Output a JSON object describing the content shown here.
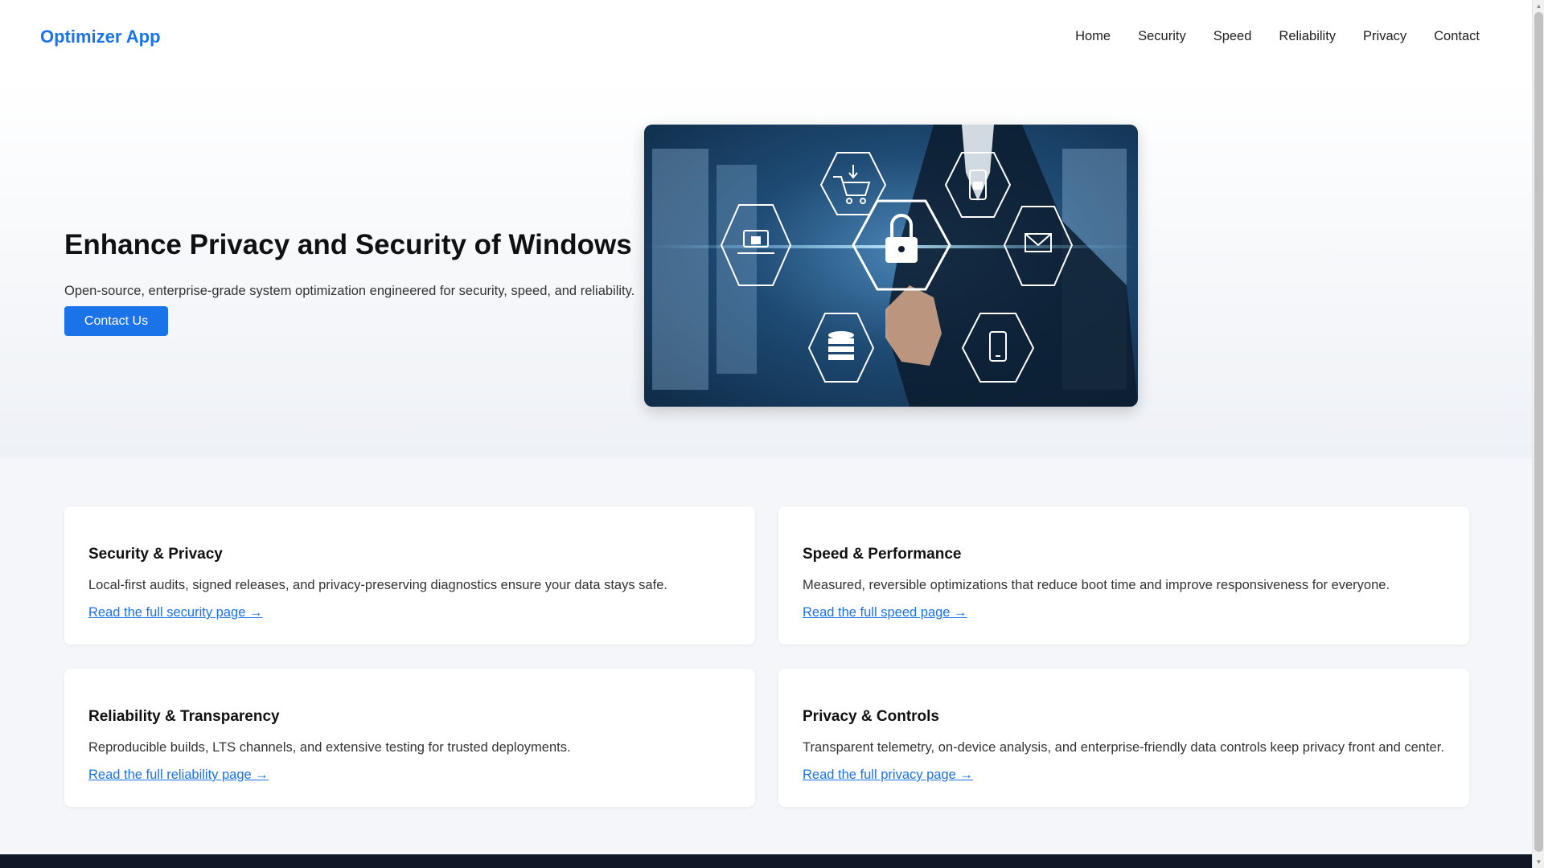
{
  "header": {
    "logo": "Optimizer App",
    "nav": [
      "Home",
      "Security",
      "Speed",
      "Reliability",
      "Privacy",
      "Contact"
    ]
  },
  "hero": {
    "title": "Enhance Privacy and Security of Windows",
    "subtitle": "Open-source, enterprise-grade system optimization engineered for security, speed, and reliability.",
    "cta": "Contact Us",
    "image_icons": [
      "shopping-cart-icon",
      "phone-lock-icon",
      "laptop-lock-icon",
      "padlock-icon",
      "mail-icon",
      "database-icon",
      "smartphone-icon"
    ]
  },
  "cards": [
    {
      "title": "Security & Privacy",
      "text": "Local-first audits, signed releases, and privacy-preserving diagnostics ensure your data stays safe.",
      "link": "Read the full security page →"
    },
    {
      "title": "Speed & Performance",
      "text": "Measured, reversible optimizations that reduce boot time and improve responsiveness for everyone.",
      "link": "Read the full speed page →"
    },
    {
      "title": "Reliability & Transparency",
      "text": "Reproducible builds, LTS channels, and extensive testing for trusted deployments.",
      "link": "Read the full reliability page →"
    },
    {
      "title": "Privacy & Controls",
      "text": "Transparent telemetry, on-device analysis, and enterprise-friendly data controls keep privacy front and center.",
      "link": "Read the full privacy page →"
    }
  ],
  "colors": {
    "accent": "#1a73e8",
    "footer": "#101828",
    "page_bg": "#f4f6fa"
  }
}
